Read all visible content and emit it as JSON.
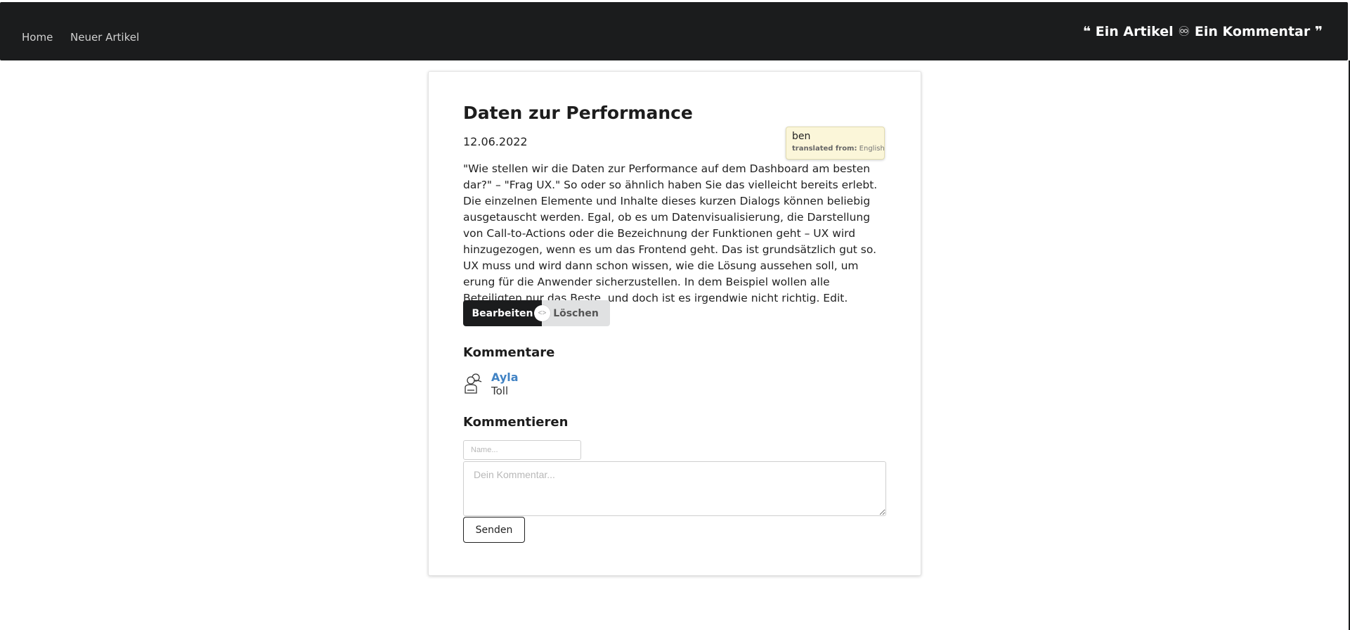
{
  "nav": {
    "links": [
      "Home",
      "Neuer Artikel"
    ],
    "brand": "❝ Ein Artikel ♾ Ein Kommentar ❞"
  },
  "article": {
    "title": "Daten zur Performance",
    "date": "12.06.2022",
    "body": "\"Wie stellen wir die Daten zur Performance auf dem Dashboard am besten dar?\" – \"Frag UX.\" So oder so ähnlich haben Sie das vielleicht bereits erlebt. Die einzelnen Elemente und Inhalte dieses kurzen Dialogs können beliebig ausgetauscht werden. Egal, ob es um Datenvisualisierung, die Darstellung von Call-to-Actions oder die Bezeichnung der Funktionen geht – UX wird hinzugezogen, wenn es um das Frontend geht. Das ist grundsätzlich gut so. UX muss und wird dann schon wissen, wie die Lösung aussehen soll, um erung für die Anwender sicherzustellen. In dem Beispiel wollen alle Beteiligten nur das Beste, und doch ist es irgendwie nicht richtig. Edit.",
    "edit_label": "Bearbeiten",
    "or_label": "<>",
    "delete_label": "Löschen"
  },
  "comments": {
    "heading": "Kommentare",
    "items": [
      {
        "author": "Ayla",
        "text": "Toll",
        "avatar_icon": "users-icon"
      }
    ]
  },
  "form": {
    "heading": "Kommentieren",
    "name_placeholder": "Name...",
    "comment_placeholder": "Dein Kommentar...",
    "submit_label": "Senden"
  },
  "tooltip": {
    "word": "ben",
    "from_label": "translated from:",
    "from_lang": "English"
  },
  "colors": {
    "navbar": "#1b1c1d",
    "link": "#4183c4",
    "tooltip_bg": "#fbf6d9"
  }
}
